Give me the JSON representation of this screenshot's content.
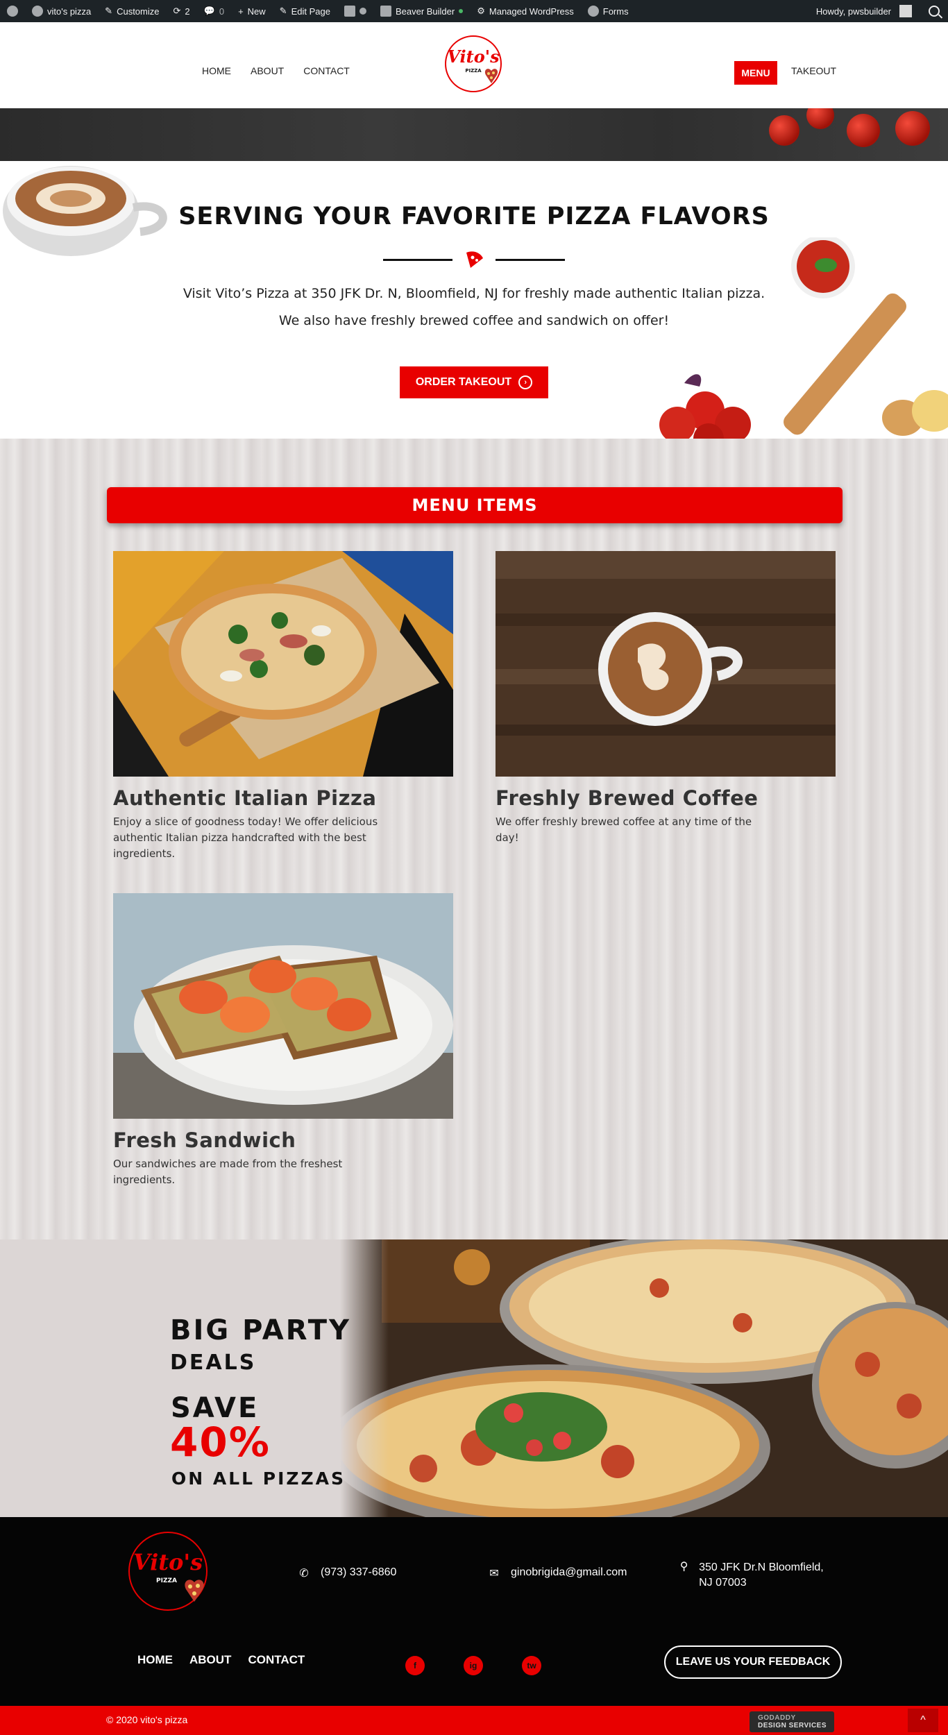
{
  "admin_bar": {
    "site_name": "vito's pizza",
    "customize": "Customize",
    "updates_count": "2",
    "comments_count": "0",
    "new": "New",
    "edit_page": "Edit Page",
    "beaver_builder": "Beaver Builder",
    "managed_wordpress": "Managed WordPress",
    "forms": "Forms",
    "howdy": "Howdy, pwsbuilder"
  },
  "header": {
    "nav_left": [
      "HOME",
      "ABOUT",
      "CONTACT"
    ],
    "logo_text": "Vito's",
    "logo_sub": "PIZZA",
    "menu_button": "MENU",
    "takeout": "TAKEOUT"
  },
  "hero": {
    "title": "SERVING YOUR FAVORITE PIZZA FLAVORS",
    "line1": "Visit Vito’s Pizza at 350 JFK Dr. N, Bloomfield, NJ for freshly made authentic Italian pizza.",
    "line2": "We also have freshly brewed coffee and sandwich on offer!",
    "order_button": "ORDER TAKEOUT"
  },
  "menu": {
    "banner": "MENU ITEMS",
    "items": [
      {
        "title": "Authentic Italian Pizza",
        "description": "Enjoy a slice of goodness today! We offer delicious authentic Italian pizza handcrafted with the best ingredients."
      },
      {
        "title": "Freshly Brewed Coffee",
        "description": "We offer freshly brewed coffee at any time of the day!"
      },
      {
        "title": "Fresh Sandwich",
        "description": "Our sandwiches are made from the freshest ingredients."
      }
    ]
  },
  "party": {
    "big": "BIG PARTY",
    "deals": "DEALS",
    "save": "SAVE",
    "percent": "40%",
    "on_all": "ON ALL PIZZAS"
  },
  "footer": {
    "phone": "(973) 337-6860",
    "email": "ginobrigida@gmail.com",
    "address": "350 JFK Dr.N Bloomfield, NJ 07003",
    "nav": [
      "HOME",
      "ABOUT",
      "CONTACT"
    ],
    "social": [
      "f",
      "ig",
      "tw"
    ],
    "feedback_button": "LEAVE US YOUR FEEDBACK"
  },
  "bottom_bar": {
    "copyright": "© 2020 vito's pizza",
    "badge_line1": "GODADDY",
    "badge_line2": "DESIGN SERVICES",
    "to_top": "^"
  },
  "colors": {
    "brand_red": "#e80000",
    "admin_bar": "#1d2327",
    "footer_bg": "#050505"
  }
}
